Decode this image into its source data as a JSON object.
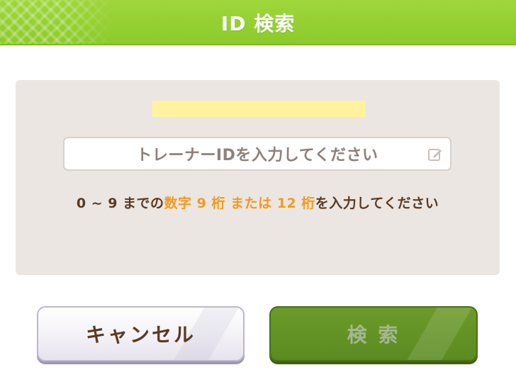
{
  "dialog": {
    "title": "ID 検索"
  },
  "search": {
    "placeholder": "トレーナーIDを入力してください",
    "icon": "pencil-icon"
  },
  "hint": {
    "part1": "0 ~ 9 までの",
    "part2": "数字 9 桁 または 12 桁",
    "part3": "を入力してください"
  },
  "buttons": {
    "cancel_label": "キャンセル",
    "search_label": "検 索"
  },
  "colors": {
    "header": "#8ccb2b",
    "panel": "#ece6e2",
    "hint_text": "#5b3a1f",
    "accent": "#f29a1e",
    "search_button": "#5b8a21",
    "highlight": "#fff3a0"
  }
}
